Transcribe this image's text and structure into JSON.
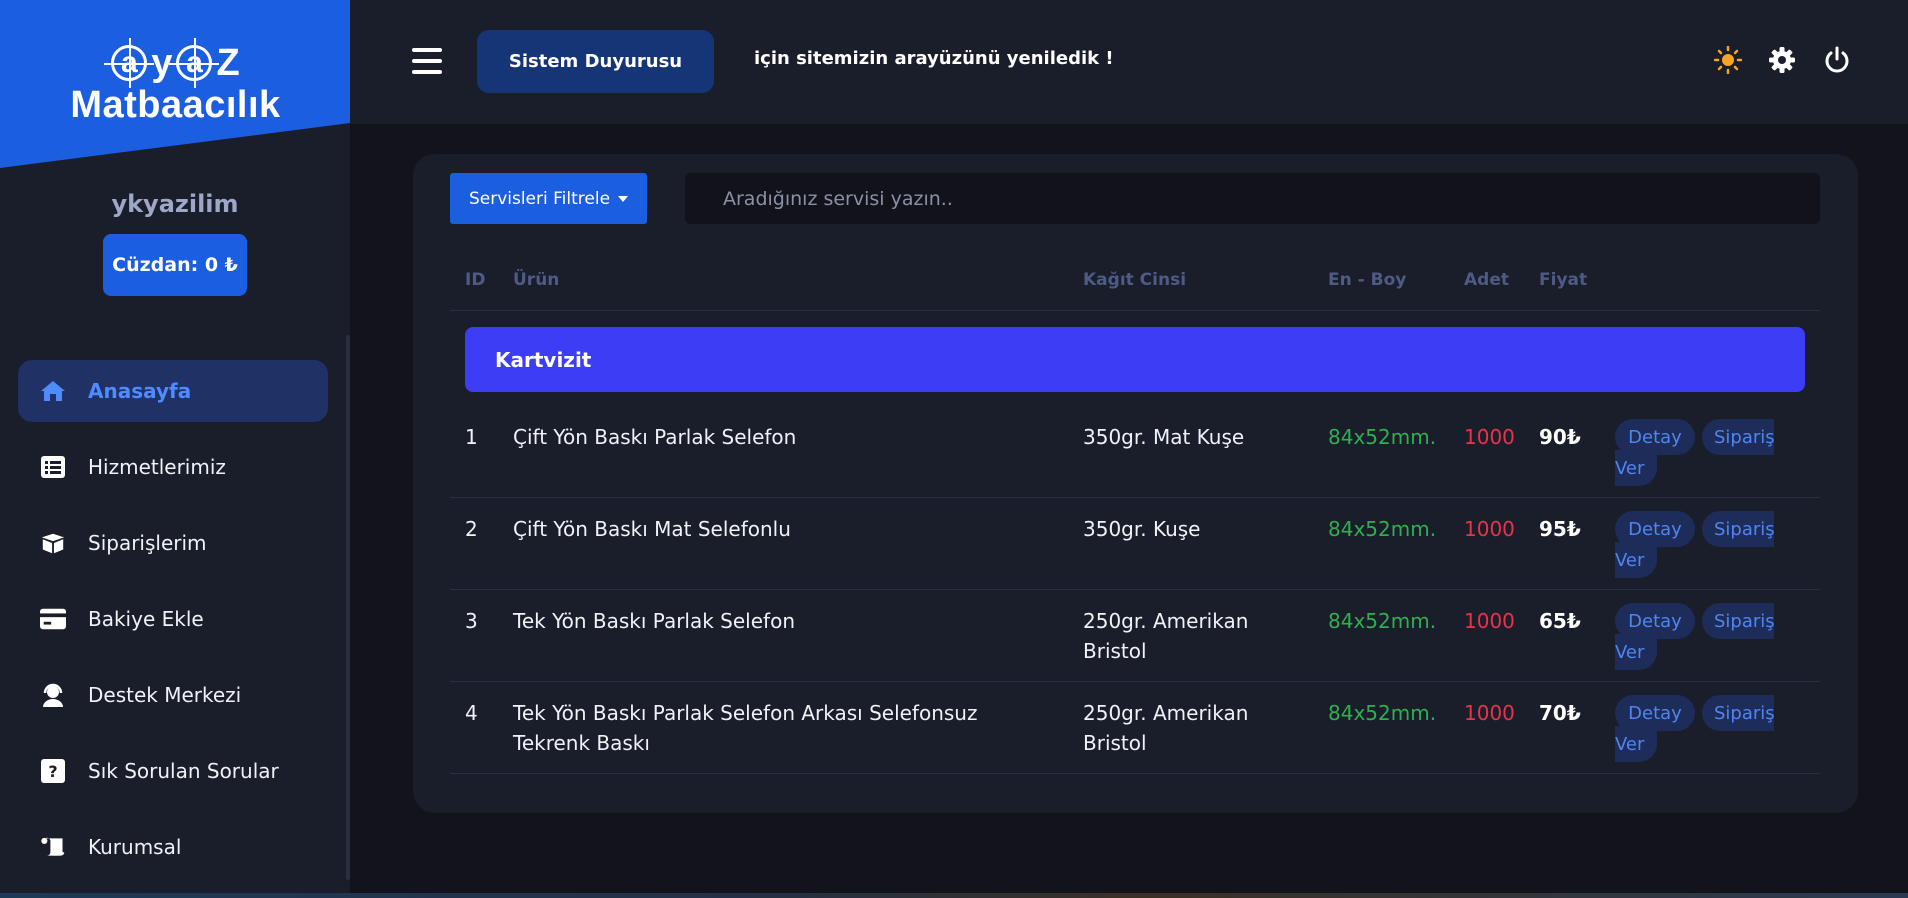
{
  "brand": {
    "letters_ring": [
      "a",
      "a"
    ],
    "letter_y": "y",
    "letter_z": "Z",
    "line2": "Matbaacılık"
  },
  "user": {
    "name": "ykyazilim",
    "wallet_label": "Cüzdan: 0 ₺"
  },
  "sidebar": {
    "items": [
      {
        "label": "Anasayfa",
        "icon": "home-icon",
        "active": true
      },
      {
        "label": "Hizmetlerimiz",
        "icon": "list-icon",
        "active": false
      },
      {
        "label": "Siparişlerim",
        "icon": "box-icon",
        "active": false
      },
      {
        "label": "Bakiye Ekle",
        "icon": "credit-card-icon",
        "active": false
      },
      {
        "label": "Destek Merkezi",
        "icon": "headset-icon",
        "active": false
      },
      {
        "label": "Sık Sorulan Sorular",
        "icon": "question-icon",
        "active": false
      },
      {
        "label": "Kurumsal",
        "icon": "scroll-icon",
        "active": false
      }
    ]
  },
  "topbar": {
    "announcement_button": "Sistem Duyurusu",
    "announcement_text": "için sitemizin arayüzünü yeniledik !",
    "icons": [
      "menu-icon",
      "sun-icon",
      "gear-icon",
      "power-icon"
    ],
    "sun_color": "#f5a623"
  },
  "filter": {
    "button_label": "Servisleri Filtrele",
    "search_placeholder": "Aradığınız servisi yazın.."
  },
  "table": {
    "headers": [
      "ID",
      "Ürün",
      "Kağıt Cinsi",
      "En - Boy",
      "Adet",
      "Fiyat"
    ],
    "category": "Kartvizit",
    "rows": [
      {
        "id": "1",
        "product": "Çift Yön Baskı Parlak Selefon",
        "paper": "350gr. Mat Kuşe",
        "size": "84x52mm.",
        "qty": "1000",
        "price": "90₺"
      },
      {
        "id": "2",
        "product": "Çift Yön Baskı Mat Selefonlu",
        "paper": "350gr. Kuşe",
        "size": "84x52mm.",
        "qty": "1000",
        "price": "95₺"
      },
      {
        "id": "3",
        "product": "Tek Yön Baskı Parlak Selefon",
        "paper": "250gr. Amerikan Bristol",
        "size": "84x52mm.",
        "qty": "1000",
        "price": "65₺"
      },
      {
        "id": "4",
        "product": "Tek Yön Baskı Parlak Selefon Arkası Selefonsuz Tekrenk Baskı",
        "paper": "250gr. Amerikan Bristol",
        "size": "84x52mm.",
        "qty": "1000",
        "price": "70₺"
      }
    ],
    "detail_label": "Detay",
    "order_label_part1": "Sipariş",
    "order_label_part2": "Ver"
  },
  "colors": {
    "accent": "#1c5ee0",
    "category_bar": "#3d3df5",
    "size_text": "#2fb04f",
    "qty_text": "#e8344a"
  }
}
